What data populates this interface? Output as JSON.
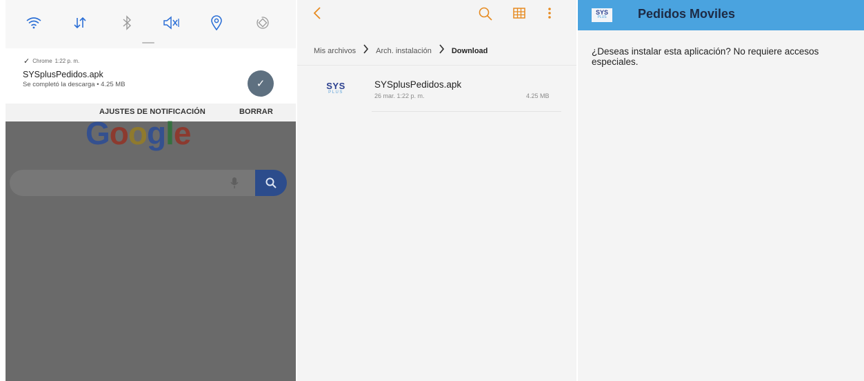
{
  "panel_notification": {
    "quick_settings": [
      {
        "name": "wifi-icon",
        "glyph": "◠"
      },
      {
        "name": "data-transfer-icon",
        "glyph": "⇅"
      },
      {
        "name": "bluetooth-icon",
        "glyph": "✱"
      },
      {
        "name": "sound-muted-icon",
        "glyph": "◁×"
      },
      {
        "name": "location-icon",
        "glyph": "◎"
      },
      {
        "name": "auto-rotate-icon",
        "glyph": "⟳"
      }
    ],
    "notification": {
      "app_name": "Chrome",
      "time": "1:22 p. m.",
      "title": "SYSplusPedidos.apk",
      "subtitle": "Se completó la descarga • 4.25 MB",
      "action_settings": "AJUSTES DE NOTIFICACIÓN",
      "action_clear": "BORRAR"
    },
    "background": {
      "logo_text": [
        "G",
        "o",
        "o",
        "g",
        "l",
        "e"
      ]
    }
  },
  "panel_files": {
    "breadcrumb": [
      "Mis archivos",
      "Arch. instalación",
      "Download"
    ],
    "file": {
      "name": "SYSplusPedidos.apk",
      "date": "26 mar. 1:22 p. m.",
      "size": "4.25 MB",
      "logo_top": "SYS",
      "logo_bottom": "PLUS"
    }
  },
  "panel_installer": {
    "app_title": "Pedidos Moviles",
    "logo_top": "SYS",
    "logo_bottom": "PLUS",
    "message": "¿Deseas instalar esta aplicación? No requiere accesos especiales."
  },
  "colors": {
    "accent_orange": "#e68a1f",
    "app_bar_blue": "#4aa3df",
    "quick_settings_blue": "#2b6fd6"
  }
}
